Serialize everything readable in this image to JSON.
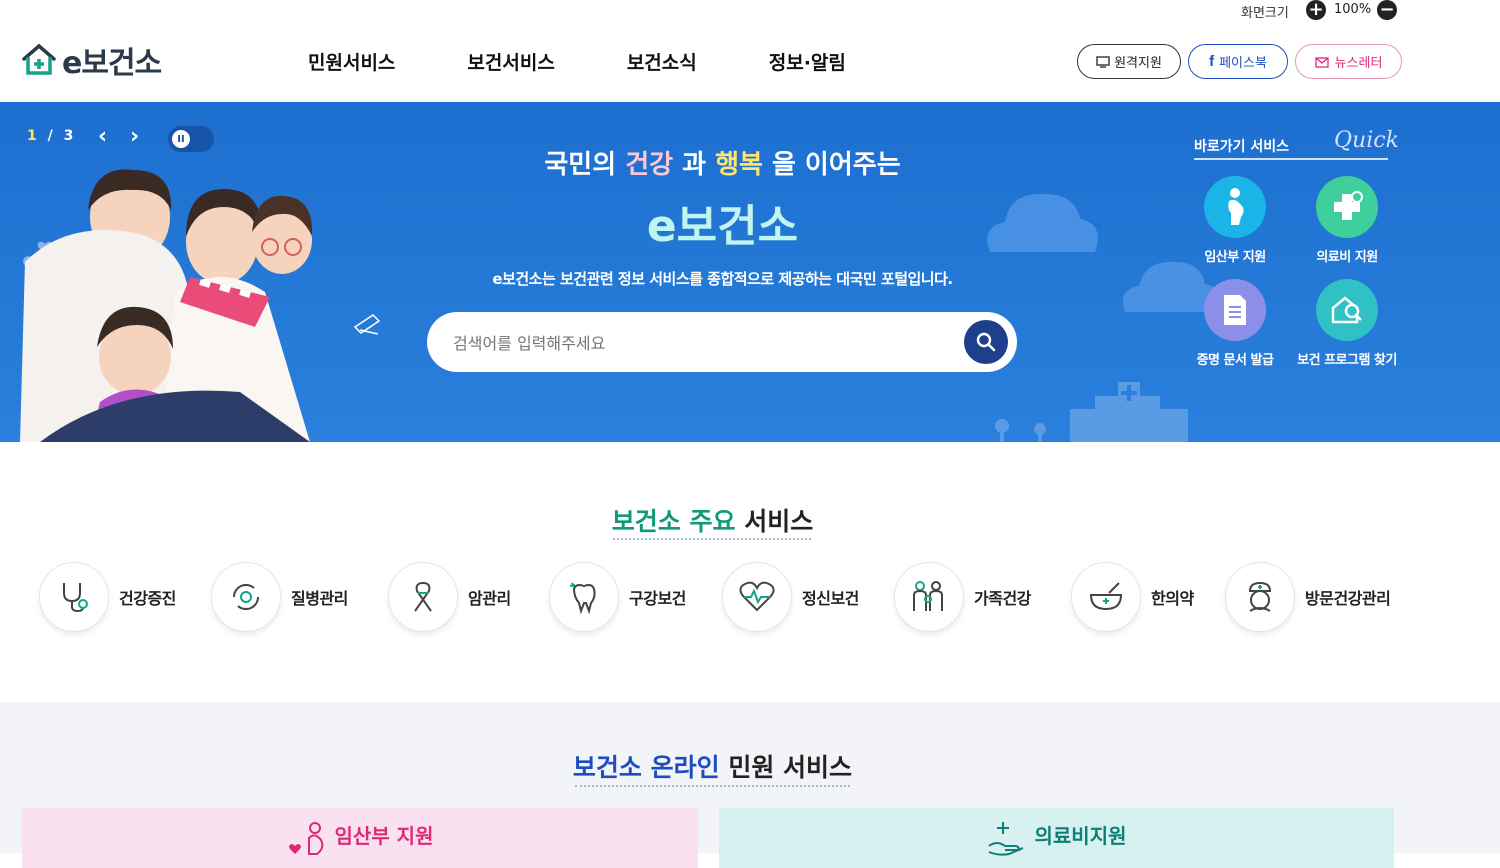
{
  "topbar": {
    "zoom_label": "화면크기",
    "zoom_in": "+",
    "zoom_value": "100%",
    "zoom_out": "−"
  },
  "header": {
    "logo_text": "e보건소",
    "nav": [
      "민원서비스",
      "보건서비스",
      "보건소식",
      "정보·알림"
    ],
    "buttons": {
      "remote": "원격지원",
      "facebook": "페이스북",
      "newsletter": "뉴스레터"
    }
  },
  "hero": {
    "slide_current": "1",
    "slide_sep": "/",
    "slide_total": "3",
    "title_pre": "국민의 ",
    "title_w1": "건강",
    "title_mid": " 과 ",
    "title_w2": "행복",
    "title_post": " 을 이어주는",
    "brand": "e보건소",
    "description": "e보건소는 보건관련 정보 서비스를 종합적으로 제공하는 대국민 포털입니다.",
    "search_placeholder": "검색어를 입력해주세요",
    "quick_title": "바로가기 서비스",
    "quick_script": "Quick",
    "quick_items": [
      "임산부 지원",
      "의료비 지원",
      "증명 문서 발급",
      "보건 프로그램 찾기"
    ]
  },
  "main_services": {
    "title_hl": "보건소 주요",
    "title_rest": " 서비스",
    "items": [
      "건강증진",
      "질병관리",
      "암관리",
      "구강보건",
      "정신보건",
      "가족건강",
      "한의약",
      "방문건강관리"
    ]
  },
  "online": {
    "title_hl": "보건소 온라인",
    "title_rest": " 민원 서비스",
    "cards": [
      "임산부 지원",
      "의료비지원"
    ]
  },
  "colors": {
    "hero_blue": "#1d6fcf",
    "accent_green": "#0f9a76",
    "accent_blue": "#1d4ec1",
    "pink": "#e0287a",
    "teal": "#0c7f78"
  }
}
